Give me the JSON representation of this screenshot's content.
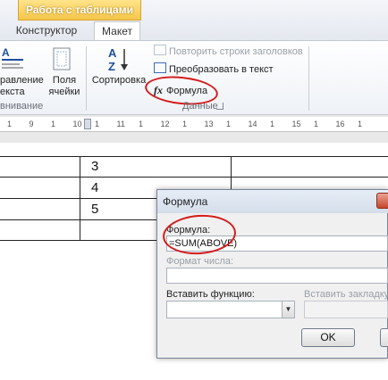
{
  "ribbon": {
    "context_header": "Работа с таблицами",
    "tabs": [
      {
        "label": "Конструктор"
      },
      {
        "label": "Макет"
      }
    ],
    "groups": {
      "alignment": {
        "button_label_line1": "равление",
        "button_label_line2": "екста",
        "group_label": "внивание"
      },
      "margins": {
        "button_label_line1": "Поля",
        "button_label_line2": "ячейки"
      },
      "data": {
        "sort_label": "Сортировка",
        "repeat_headers": "Повторить строки заголовков",
        "convert_to_text": "Преобразовать в текст",
        "formula": "Формула",
        "group_label": "Данные"
      }
    }
  },
  "ruler": {
    "numbers": [
      "1",
      "9",
      "1",
      "10",
      "1",
      "11",
      "1",
      "12",
      "1",
      "13",
      "1",
      "14",
      "1",
      "15",
      "1",
      "16",
      "1"
    ]
  },
  "table": {
    "values": [
      "3",
      "4",
      "5"
    ]
  },
  "dialog": {
    "title": "Формула",
    "formula_label": "Формула:",
    "formula_value": "=SUM(ABOVE)",
    "number_format_label": "Формат числа:",
    "insert_function_label": "Вставить функцию:",
    "insert_bookmark_label": "Вставить закладку",
    "ok_label": "OK"
  }
}
